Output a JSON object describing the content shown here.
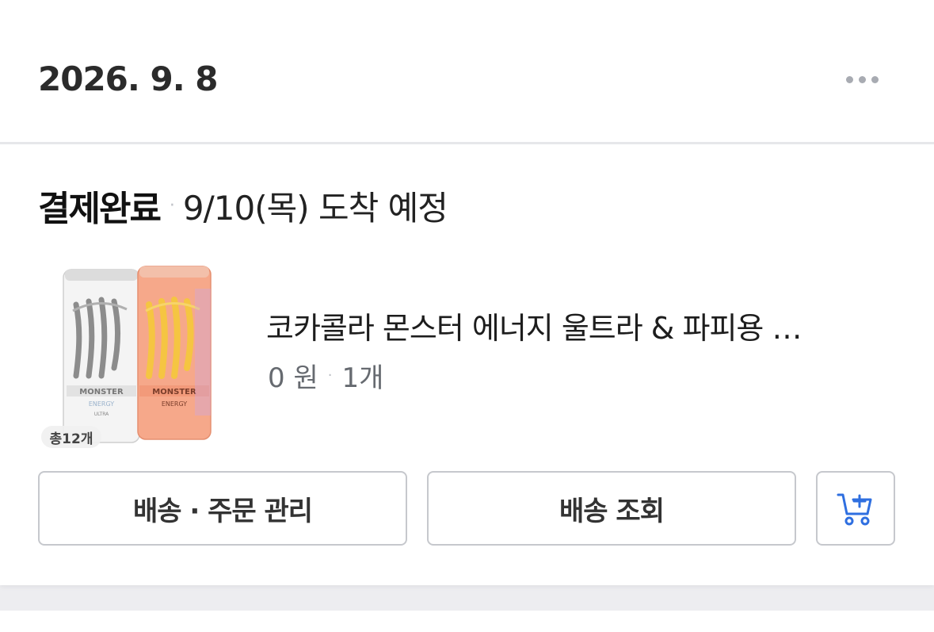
{
  "order": {
    "date": "2026. 9. 8",
    "status": "결제완료",
    "separator": "·",
    "arrival": "9/10(목) 도착 예정"
  },
  "product": {
    "name": "코카콜라 몬스터 에너지 울트라 & 파피용 …",
    "price": "0 원",
    "separator": "·",
    "quantity": "1개",
    "image_badge": "총12개",
    "image_description_icons": [
      "monster-ultra-can",
      "monster-pipeline-punch-can"
    ]
  },
  "buttons": {
    "manage": "배송 · 주문 관리",
    "track": "배송 조회",
    "cart_icon": "add-to-cart-icon"
  },
  "colors": {
    "accent_blue": "#2f6fe0",
    "border": "#c6c8cd",
    "divider": "#e6e7ea",
    "muted_text": "#666a70"
  }
}
